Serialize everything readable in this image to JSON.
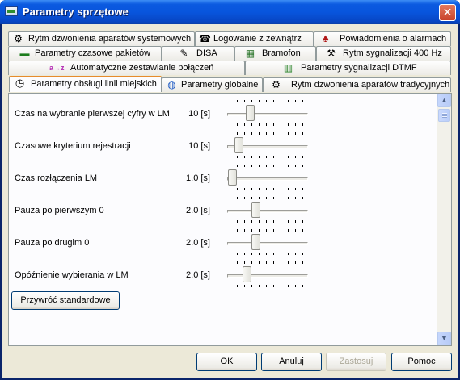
{
  "window": {
    "title": "Parametry sprzętowe",
    "close_glyph": "✕"
  },
  "tabs": {
    "row1": [
      {
        "label": "Rytm dzwonienia aparatów systemowych",
        "icon": "gear-icon"
      },
      {
        "label": "Logowanie z zewnątrz",
        "icon": "phone-icon"
      },
      {
        "label": "Powiadomienia o alarmach",
        "icon": "alarm-icon"
      }
    ],
    "row2": [
      {
        "label": "Parametry czasowe pakietów",
        "icon": "packet-icon"
      },
      {
        "label": "DISA",
        "icon": "wrench-icon"
      },
      {
        "label": "Bramofon",
        "icon": "intercom-icon"
      },
      {
        "label": "Rytm sygnalizacji 400 Hz",
        "icon": "tools-icon"
      }
    ],
    "row3": [
      {
        "label": "Automatyczne zestawianie połączeń",
        "icon": "az-icon"
      },
      {
        "label": "Parametry sygnalizacji DTMF",
        "icon": "dtmf-icon"
      }
    ],
    "row4": [
      {
        "label": "Parametry obsługi linii miejskich",
        "icon": "clock-icon",
        "active": true
      },
      {
        "label": "Parametry globalne",
        "icon": "globe-icon"
      },
      {
        "label": "Rytm dzwonienia aparatów tradycyjnych",
        "icon": "gear-icon"
      }
    ]
  },
  "params": [
    {
      "label": "Czas na wybranie pierwszej cyfry w LM",
      "value": "10 [s]",
      "level": 0.25
    },
    {
      "label": "Czasowe kryterium rejestracji",
      "value": "10 [s]",
      "level": 0.09
    },
    {
      "label": "Czas rozłączenia LM",
      "value": "1.0 [s]",
      "level": 0.0
    },
    {
      "label": "Pauza po pierwszym 0",
      "value": "2.0 [s]",
      "level": 0.33
    },
    {
      "label": "Pauza po drugim 0",
      "value": "2.0 [s]",
      "level": 0.33
    },
    {
      "label": "Opóźnienie wybierania w LM",
      "value": "2.0 [s]",
      "level": 0.2
    }
  ],
  "reset_button": "Przywróć standardowe",
  "buttons": {
    "ok": "OK",
    "cancel": "Anuluj",
    "apply": "Zastosuj",
    "help": "Pomoc"
  },
  "scroll": {
    "up": "▲",
    "down": "▼"
  },
  "colors": {
    "title_bar": "#0855dd",
    "active_tab_accent": "#e68b2c",
    "dialog_bg": "#ece9d8"
  }
}
